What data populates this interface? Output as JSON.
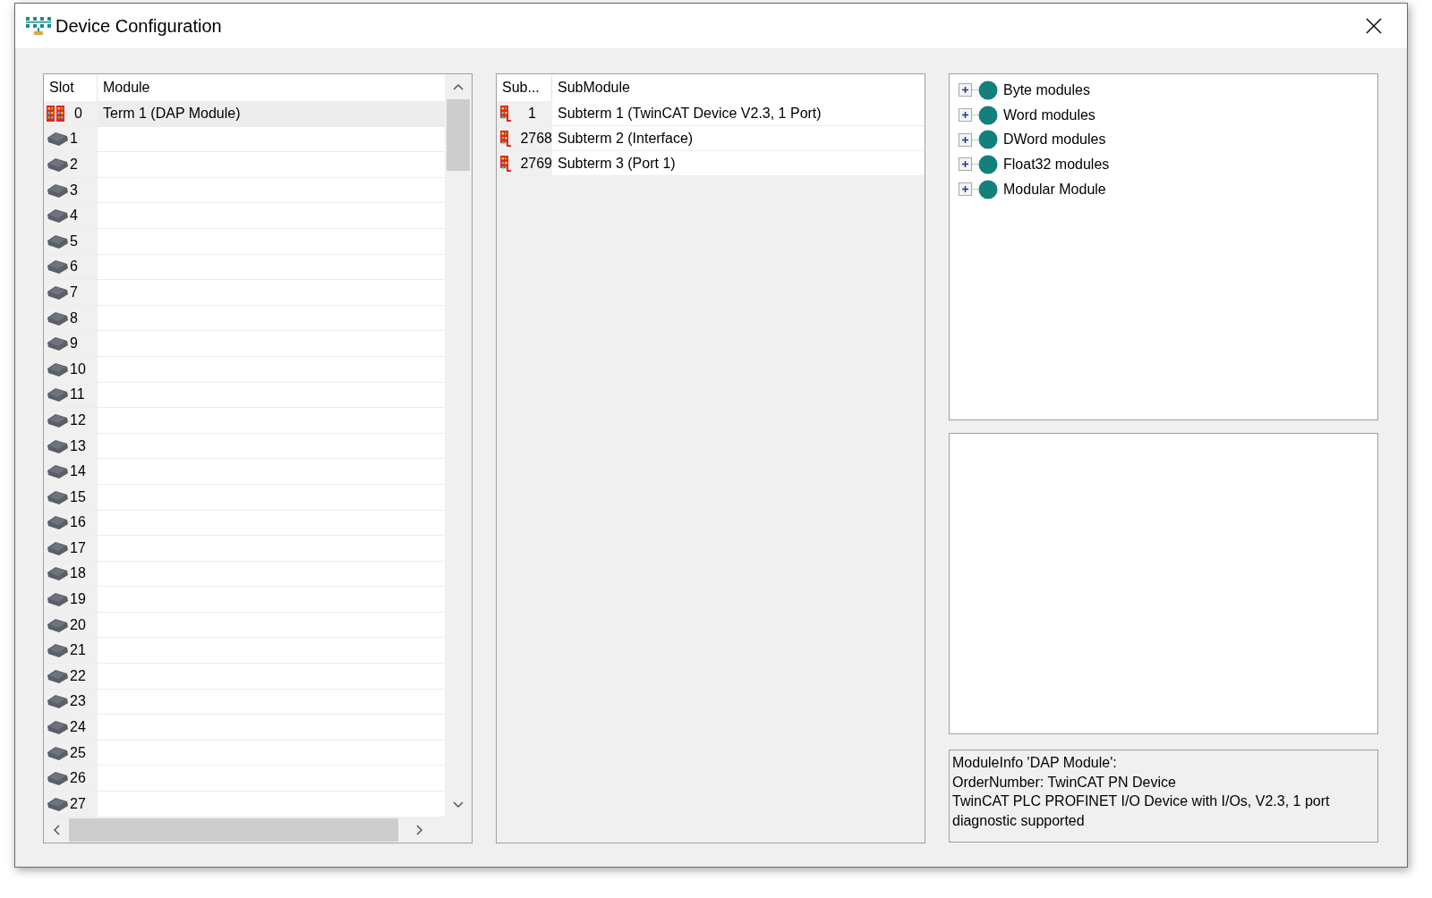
{
  "window": {
    "title": "Device Configuration"
  },
  "module_table": {
    "columns": [
      "Slot",
      "Module"
    ],
    "rows": [
      {
        "kind": "dap",
        "slot": "0",
        "module": "Term 1 (DAP Module)",
        "selected": true
      },
      {
        "kind": "empty",
        "slot": "1",
        "selected": false
      },
      {
        "kind": "empty",
        "slot": "2",
        "selected": false
      },
      {
        "kind": "empty",
        "slot": "3",
        "selected": false
      },
      {
        "kind": "empty",
        "slot": "4",
        "selected": false
      },
      {
        "kind": "empty",
        "slot": "5",
        "selected": false
      },
      {
        "kind": "empty",
        "slot": "6",
        "selected": false
      },
      {
        "kind": "empty",
        "slot": "7",
        "selected": false
      },
      {
        "kind": "empty",
        "slot": "8",
        "selected": false
      },
      {
        "kind": "empty",
        "slot": "9",
        "selected": false
      },
      {
        "kind": "empty",
        "slot": "10",
        "selected": false
      },
      {
        "kind": "empty",
        "slot": "11",
        "selected": false
      },
      {
        "kind": "empty",
        "slot": "12",
        "selected": false
      },
      {
        "kind": "empty",
        "slot": "13",
        "selected": false
      },
      {
        "kind": "empty",
        "slot": "14",
        "selected": false
      },
      {
        "kind": "empty",
        "slot": "15",
        "selected": false
      },
      {
        "kind": "empty",
        "slot": "16",
        "selected": false
      },
      {
        "kind": "empty",
        "slot": "17",
        "selected": false
      },
      {
        "kind": "empty",
        "slot": "18",
        "selected": false
      },
      {
        "kind": "empty",
        "slot": "19",
        "selected": false
      },
      {
        "kind": "empty",
        "slot": "20",
        "selected": false
      },
      {
        "kind": "empty",
        "slot": "21",
        "selected": false
      },
      {
        "kind": "empty",
        "slot": "22",
        "selected": false
      },
      {
        "kind": "empty",
        "slot": "23",
        "selected": false
      },
      {
        "kind": "empty",
        "slot": "24",
        "selected": false
      },
      {
        "kind": "empty",
        "slot": "25",
        "selected": false
      },
      {
        "kind": "empty",
        "slot": "26",
        "selected": false
      },
      {
        "kind": "empty",
        "slot": "27",
        "selected": false
      }
    ]
  },
  "submodule_table": {
    "columns": [
      "Sub...",
      "SubModule"
    ],
    "rows": [
      {
        "sub": "1",
        "submodule": "Subterm 1 (TwinCAT Device V2.3, 1 Port)"
      },
      {
        "sub": "2768",
        "submodule": "Subterm 2 (Interface)"
      },
      {
        "sub": "2769",
        "submodule": "Subterm 3 (Port 1)"
      }
    ]
  },
  "catalog_tree": [
    {
      "label": "Byte modules",
      "expanded": false
    },
    {
      "label": "Word modules",
      "expanded": false
    },
    {
      "label": "DWord modules",
      "expanded": false
    },
    {
      "label": "Float32 modules",
      "expanded": false
    },
    {
      "label": "Modular Module",
      "expanded": false
    }
  ],
  "module_info": [
    "ModuleInfo 'DAP Module':",
    "OrderNumber: TwinCAT PN Device",
    "TwinCAT PLC PROFINET I/O Device with I/Os, V2.3, 1 port diagnostic supported"
  ]
}
